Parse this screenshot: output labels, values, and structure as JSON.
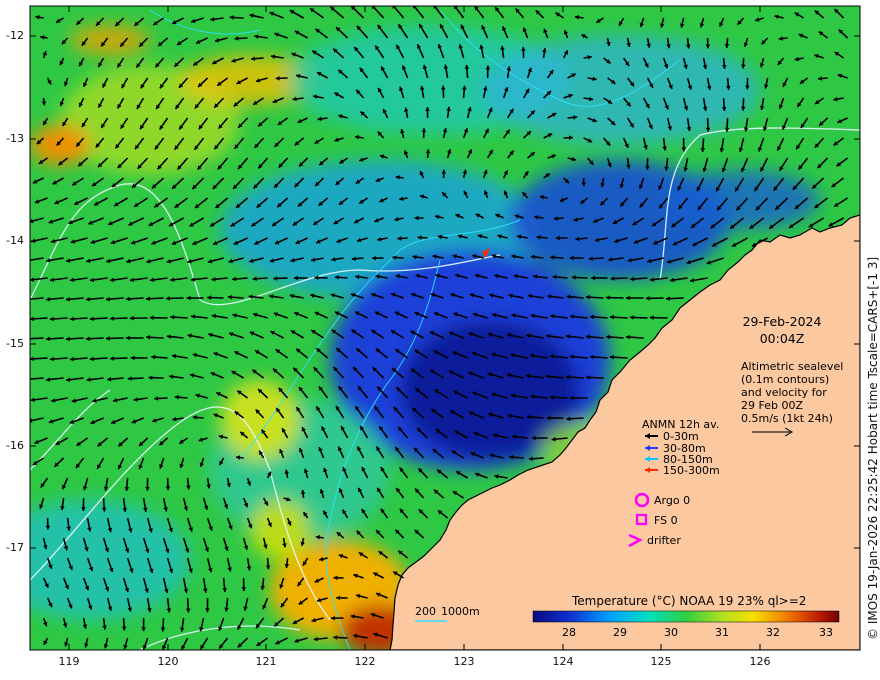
{
  "map": {
    "y_ticks": [
      "-12",
      "-13",
      "-14",
      "-15",
      "-16",
      "-17"
    ],
    "x_ticks": [
      "119",
      "120",
      "121",
      "122",
      "123",
      "124",
      "125",
      "126"
    ],
    "lon_range": [
      118.6,
      126.9
    ],
    "lat_range": [
      -17.95,
      -11.65
    ]
  },
  "side_text": "© IMOS 19-Jan-2026 22:25:42 Hobart time Tscale=CARS+[-1 3]",
  "date": {
    "day": "29-Feb-2024",
    "time": "00:04Z"
  },
  "altimetry_note": [
    "Altimetric sealevel",
    "(0.1m contours)",
    "and velocity for",
    "29 Feb 00Z",
    "0.5m/s (1kt 24h)"
  ],
  "anmn": {
    "title": "ANMN 12h av.",
    "items": [
      {
        "label": "0-30m",
        "color": "#000000"
      },
      {
        "label": "30-80m",
        "color": "#1f3cff"
      },
      {
        "label": "80-150m",
        "color": "#00c8ff"
      },
      {
        "label": "150-300m",
        "color": "#ff2a00"
      }
    ]
  },
  "markers": {
    "argo": "Argo 0",
    "fs": "FS 0",
    "drifter": "drifter",
    "color": "#ff00ff"
  },
  "depth_legend": {
    "d200": "200",
    "d1000": "1000m"
  },
  "colorbar": {
    "title": "Temperature (°C) NOAA 19 23% ql>=2",
    "ticks": [
      "28",
      "29",
      "30",
      "31",
      "32",
      "33"
    ]
  },
  "colors": {
    "land": "#fbc8a0",
    "cold": "#0a1a9a",
    "warm": "#a01500"
  }
}
